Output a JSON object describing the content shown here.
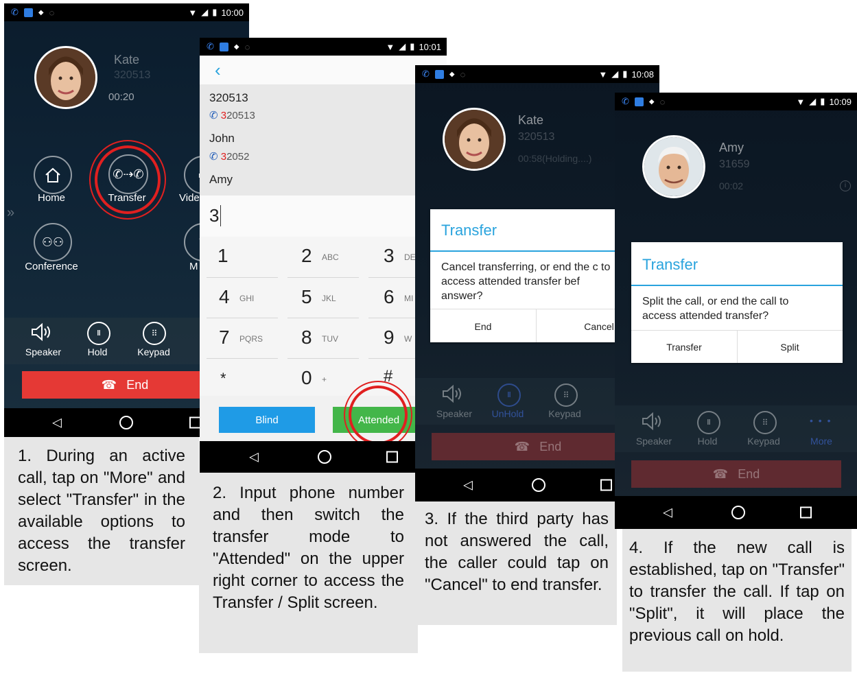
{
  "status": {
    "time1": "10:00",
    "time2": "10:01",
    "time3": "10:08",
    "time4": "10:09"
  },
  "screen1": {
    "caller_name": "Kate",
    "caller_number": "320513",
    "duration": "00:20",
    "buttons": {
      "home": "Home",
      "transfer": "Transfer",
      "video": "Vide",
      "conference": "Conference",
      "mute": "M"
    },
    "bottom": {
      "speaker": "Speaker",
      "hold": "Hold",
      "keypad": "Keypad"
    },
    "end_label": "End"
  },
  "screen2": {
    "contacts": [
      {
        "name": "320513",
        "number_hl": "3",
        "number_rest": "20513"
      },
      {
        "name": "John",
        "number_hl": "3",
        "number_rest": "2052"
      },
      {
        "name": "Amy"
      }
    ],
    "input_value": "3",
    "keys": [
      {
        "num": "1",
        "sub": ""
      },
      {
        "num": "2",
        "sub": "ABC"
      },
      {
        "num": "3",
        "sub": "DE"
      },
      {
        "num": "4",
        "sub": "GHI"
      },
      {
        "num": "5",
        "sub": "JKL"
      },
      {
        "num": "6",
        "sub": "MI"
      },
      {
        "num": "7",
        "sub": "PQRS"
      },
      {
        "num": "8",
        "sub": "TUV"
      },
      {
        "num": "9",
        "sub": "W"
      },
      {
        "num": "*",
        "sub": ""
      },
      {
        "num": "0",
        "sub": "+"
      },
      {
        "num": "#",
        "sub": ""
      }
    ],
    "blind_label": "Blind",
    "attended_label": "Attended"
  },
  "screen3": {
    "caller_name": "Kate",
    "caller_number": "320513",
    "duration": "00:58(Holding....)",
    "dialog": {
      "title": "Transfer",
      "body": "Cancel transferring, or end the c to access attended transfer bef answer?",
      "btn1": "End",
      "btn2": "Cancel"
    },
    "bottom": {
      "speaker": "Speaker",
      "unhold": "UnHold",
      "keypad": "Keypad"
    },
    "end_label": "End"
  },
  "screen4": {
    "caller_name": "Amy",
    "caller_number": "31659",
    "duration": "00:02",
    "dialog": {
      "title": "Transfer",
      "body": "Split the call, or end the call to access attended transfer?",
      "btn1": "Transfer",
      "btn2": "Split"
    },
    "bottom": {
      "speaker": "Speaker",
      "hold": "Hold",
      "keypad": "Keypad",
      "more": "More"
    },
    "end_label": "End"
  },
  "captions": {
    "c1": "1. During an active call, tap on \"More\" and select \"Transfer\" in the available options to access the transfer screen.",
    "c2": "2. Input phone number and then switch the transfer mode to \"Attended\" on the upper right corner to access the Transfer / Split screen.",
    "c3": "3. If the third party has not answered the call, the caller could tap on \"Cancel\" to end transfer.",
    "c4": "4. If the new call is established, tap on \"Transfer\" to transfer the call. If tap on \"Split\", it will place the previous call on hold."
  },
  "colors": {
    "accent_blue": "#29a3dd",
    "end_red": "#e53935",
    "attended_green": "#43b649",
    "blind_blue": "#1f9be6",
    "highlight_red": "#e02020"
  }
}
